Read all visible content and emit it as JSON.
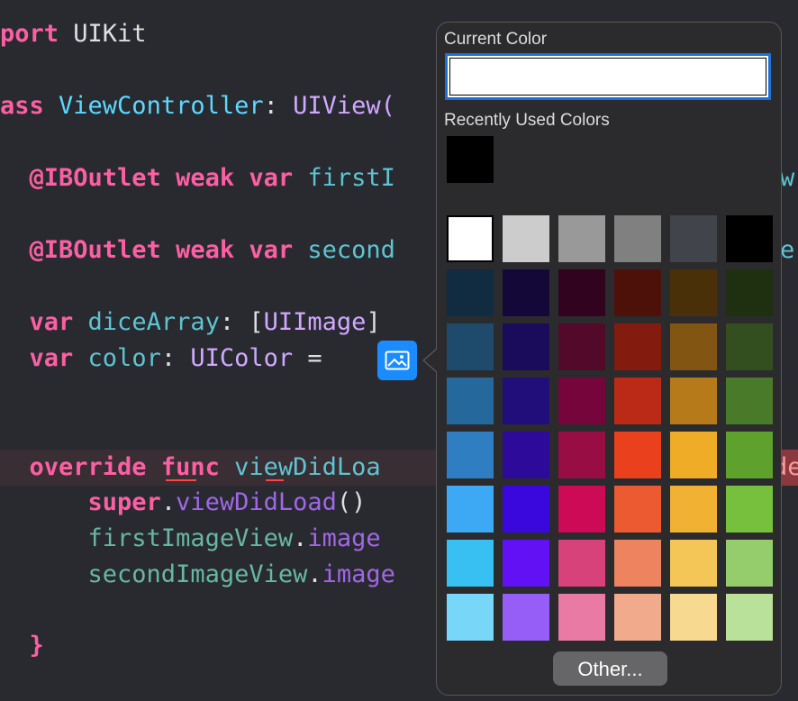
{
  "editor": {
    "lines": [
      {
        "tokens": [
          {
            "t": "port ",
            "c": "kw"
          },
          {
            "t": "UIKit",
            "c": "plain"
          }
        ]
      },
      {
        "tokens": [
          {
            "t": "ass ",
            "c": "kw"
          },
          {
            "t": "ViewController",
            "c": "type"
          },
          {
            "t": ": ",
            "c": "plain"
          },
          {
            "t": "UIView(",
            "c": "cls"
          }
        ]
      },
      {
        "tokens": [
          {
            "t": "  @IBOutlet ",
            "c": "kw"
          },
          {
            "t": "weak ",
            "c": "kw"
          },
          {
            "t": "var ",
            "c": "kw"
          },
          {
            "t": "firstI",
            "c": "prop"
          }
        ]
      },
      {
        "tokens": [
          {
            "t": "  @IBOutlet ",
            "c": "kw"
          },
          {
            "t": "weak ",
            "c": "kw"
          },
          {
            "t": "var ",
            "c": "kw"
          },
          {
            "t": "second",
            "c": "prop"
          }
        ]
      },
      {
        "tokens": [
          {
            "t": "  var ",
            "c": "kw"
          },
          {
            "t": "diceArray",
            "c": "prop"
          },
          {
            "t": ": [",
            "c": "plain"
          },
          {
            "t": "UIImage",
            "c": "cls"
          },
          {
            "t": "]",
            "c": "plain"
          }
        ]
      },
      {
        "tokens": [
          {
            "t": "  var ",
            "c": "kw"
          },
          {
            "t": "color",
            "c": "prop"
          },
          {
            "t": ": ",
            "c": "plain"
          },
          {
            "t": "UIColor",
            "c": "cls"
          },
          {
            "t": " =",
            "c": "plain"
          }
        ]
      },
      {
        "tokens": [
          {
            "t": "  override ",
            "c": "kw"
          },
          {
            "t": "func ",
            "c": "kw"
          },
          {
            "t": "viewDidLoa",
            "c": "prop"
          }
        ]
      },
      {
        "tokens": [
          {
            "t": "      super",
            "c": "kw"
          },
          {
            "t": ".",
            "c": "plain"
          },
          {
            "t": "viewDidLoad",
            "c": "fn"
          },
          {
            "t": "()",
            "c": "plain"
          }
        ]
      },
      {
        "tokens": [
          {
            "t": "      firstImageView",
            "c": "teal"
          },
          {
            "t": ".",
            "c": "plain"
          },
          {
            "t": "image",
            "c": "fn"
          }
        ]
      },
      {
        "tokens": [
          {
            "t": "      secondImageView",
            "c": "teal"
          },
          {
            "t": ".",
            "c": "plain"
          },
          {
            "t": "image",
            "c": "fn"
          }
        ]
      },
      {
        "tokens": [
          {
            "t": "  }",
            "c": "kw"
          }
        ]
      }
    ],
    "right_edge": {
      "line3": "w",
      "line4": "e",
      "line7": "de"
    },
    "literal_icon": "image-literal-icon"
  },
  "popover": {
    "current_color_label": "Current Color",
    "current_color": "#ffffff",
    "recent_label": "Recently Used Colors",
    "recent_colors": [
      "#000000"
    ],
    "swatches": [
      [
        "#ffffff",
        "#cccccc",
        "#999999",
        "#808080",
        "#41444b",
        "#000000"
      ],
      [
        "#112c41",
        "#130838",
        "#32031e",
        "#4e1109",
        "#4a3008",
        "#1f3011"
      ],
      [
        "#1e4a6c",
        "#1a0c5a",
        "#530a2a",
        "#831b0f",
        "#825513",
        "#334f1f"
      ],
      [
        "#24689c",
        "#220e7a",
        "#75053b",
        "#bb2a16",
        "#b77a1b",
        "#487a2a"
      ],
      [
        "#2f7ec2",
        "#2d0a9a",
        "#970d44",
        "#ea401d",
        "#eeac27",
        "#5ea12d"
      ],
      [
        "#3da8f4",
        "#3a07dd",
        "#cd0a55",
        "#ec5a32",
        "#f1b233",
        "#76c03e"
      ],
      [
        "#39c0f2",
        "#6211f5",
        "#d8427b",
        "#ee8360",
        "#f4c658",
        "#95cd6c"
      ],
      [
        "#78d6f8",
        "#965ef6",
        "#e97aa4",
        "#f2aa8d",
        "#f7d98f",
        "#b9e19a"
      ]
    ],
    "selected_swatch": "#ffffff",
    "other_button": "Other..."
  }
}
